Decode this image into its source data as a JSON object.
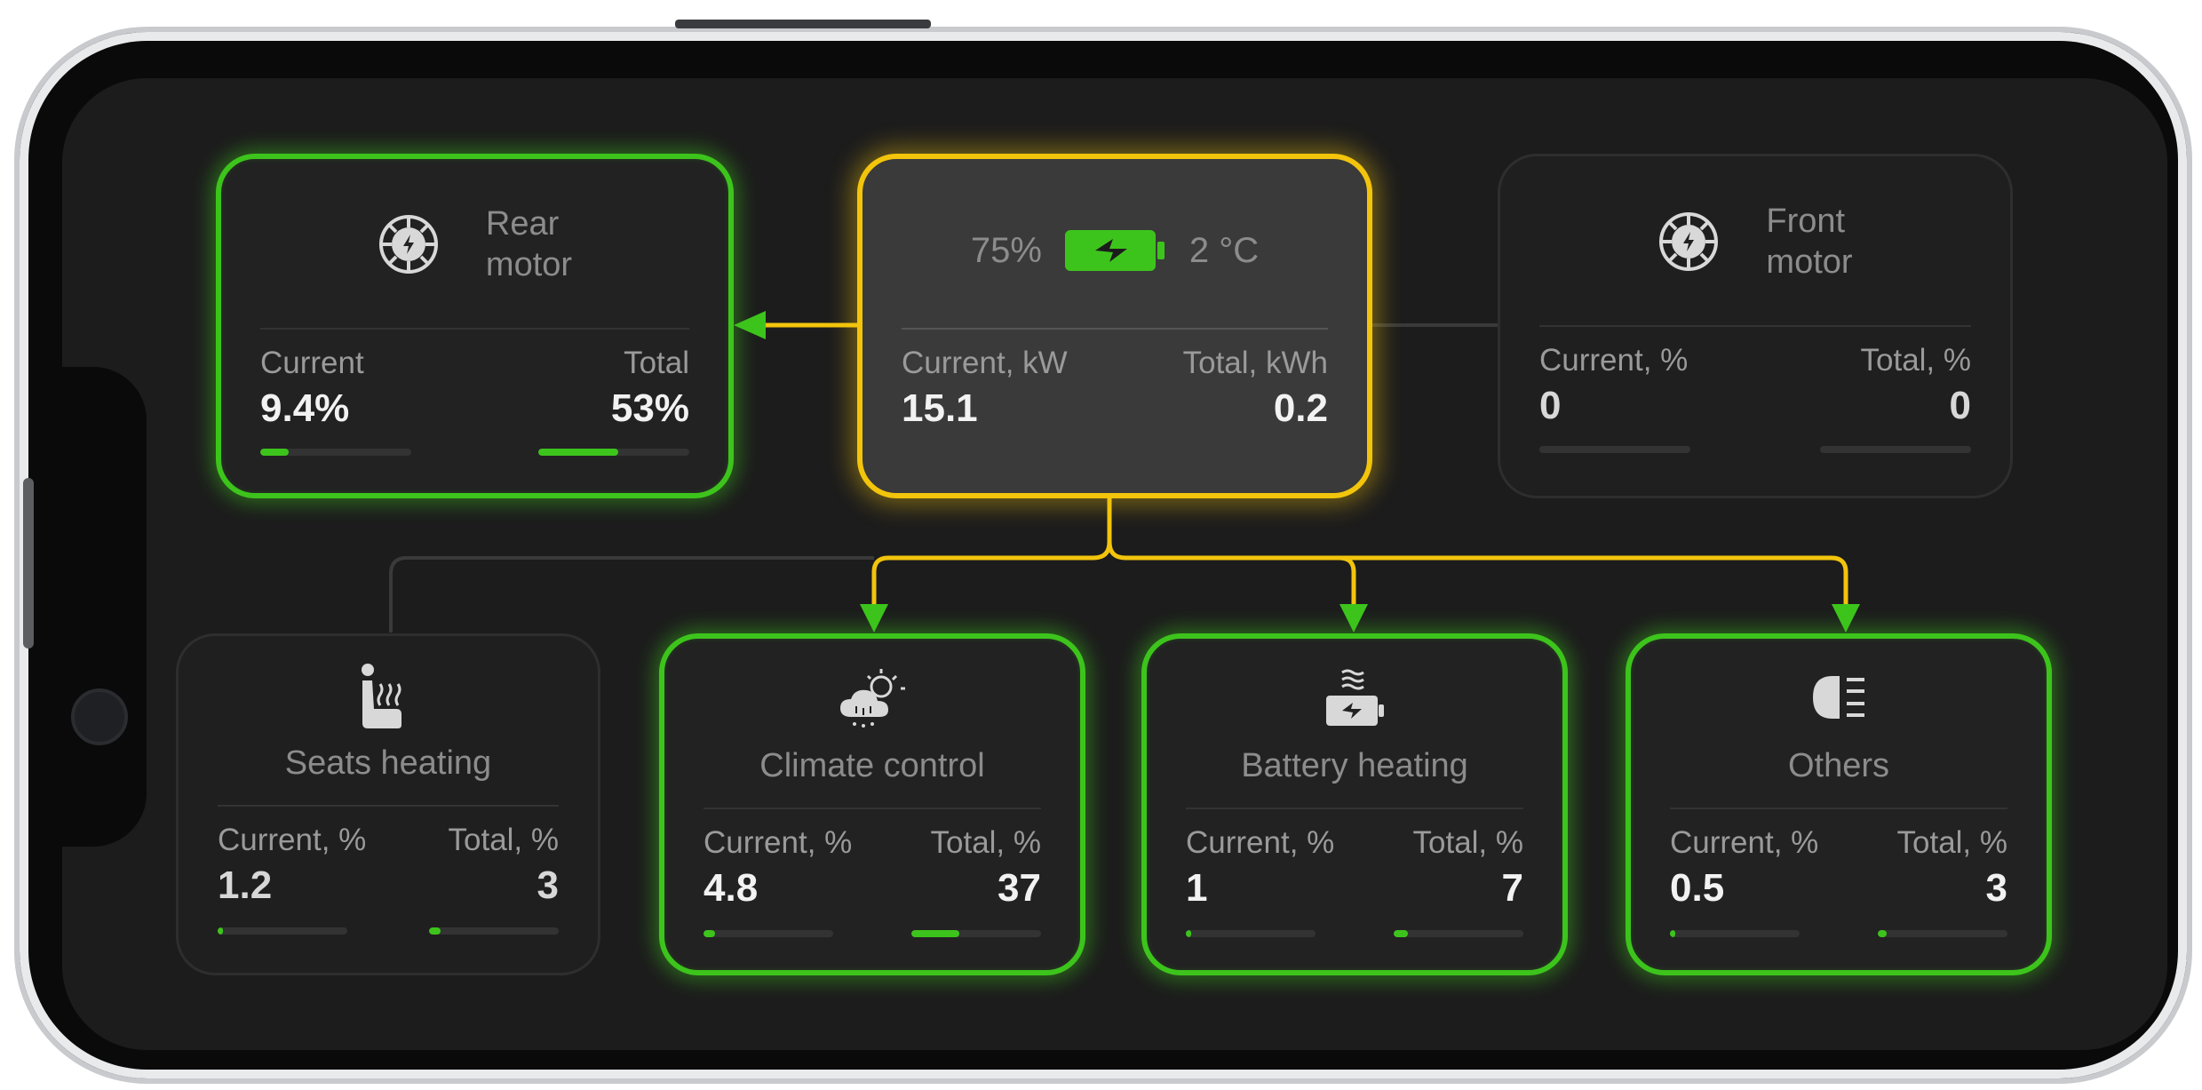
{
  "colors": {
    "active": "#3dc41c",
    "source": "#f2c40c",
    "inactive": "#2e2e2e",
    "background": "#1c1c1c"
  },
  "battery": {
    "charge": "75%",
    "temperature": "2 °C",
    "current_label": "Current, kW",
    "current_value": "15.1",
    "total_label": "Total, kWh",
    "total_value": "0.2",
    "icon": "battery-charging-icon"
  },
  "rear_motor": {
    "title_line1": "Rear",
    "title_line2": "motor",
    "current_label": "Current",
    "current_value": "9.4%",
    "total_label": "Total",
    "total_value": "53%",
    "current_level": 0.19,
    "total_level": 0.53,
    "icon": "motor-icon",
    "state": "active"
  },
  "front_motor": {
    "title_line1": "Front",
    "title_line2": "motor",
    "current_label": "Current, %",
    "current_value": "0",
    "total_label": "Total, %",
    "total_value": "0",
    "current_level": 0,
    "total_level": 0,
    "icon": "motor-icon",
    "state": "inactive"
  },
  "consumers": [
    {
      "title": "Seats heating",
      "current_label": "Current, %",
      "current_value": "1.2",
      "total_label": "Total, %",
      "total_value": "3",
      "current_level": 0.04,
      "total_level": 0.09,
      "icon": "seat-heating-icon",
      "state": "inactive"
    },
    {
      "title": "Climate control",
      "current_label": "Current, %",
      "current_value": "4.8",
      "total_label": "Total, %",
      "total_value": "37",
      "current_level": 0.09,
      "total_level": 0.37,
      "icon": "climate-icon",
      "state": "active"
    },
    {
      "title": "Battery heating",
      "current_label": "Current, %",
      "current_value": "1",
      "total_label": "Total, %",
      "total_value": "7",
      "current_level": 0.04,
      "total_level": 0.11,
      "icon": "battery-heating-icon",
      "state": "active"
    },
    {
      "title": "Others",
      "current_label": "Current, %",
      "current_value": "0.5",
      "total_label": "Total, %",
      "total_value": "3",
      "current_level": 0.04,
      "total_level": 0.07,
      "icon": "headlight-icon",
      "state": "active"
    }
  ]
}
